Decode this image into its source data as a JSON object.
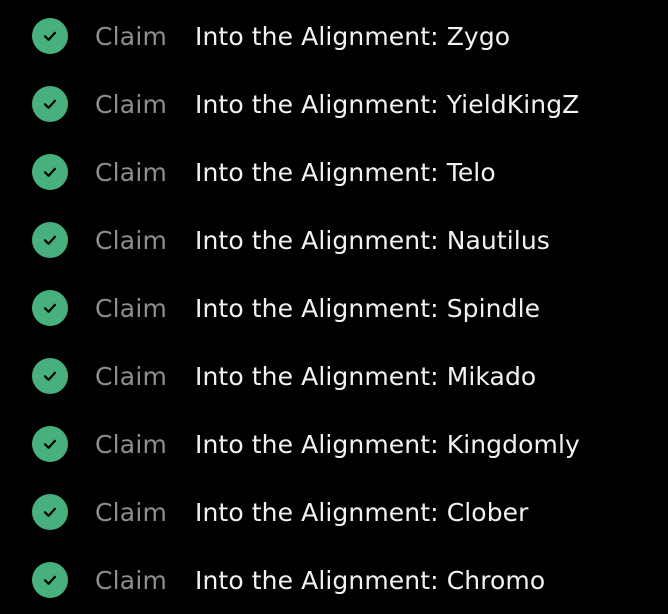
{
  "colors": {
    "background": "#000000",
    "check_badge": "#48b07f",
    "check_mark": "#000000",
    "claim_text": "#8d8d92",
    "title_text": "#f2f2f2"
  },
  "tasks": [
    {
      "status_icon": "check-circle-icon",
      "action": "Claim",
      "title": "Into the Alignment: Zygo"
    },
    {
      "status_icon": "check-circle-icon",
      "action": "Claim",
      "title": "Into the Alignment: YieldKingZ"
    },
    {
      "status_icon": "check-circle-icon",
      "action": "Claim",
      "title": "Into the Alignment: Telo"
    },
    {
      "status_icon": "check-circle-icon",
      "action": "Claim",
      "title": "Into the Alignment: Nautilus"
    },
    {
      "status_icon": "check-circle-icon",
      "action": "Claim",
      "title": "Into the Alignment: Spindle"
    },
    {
      "status_icon": "check-circle-icon",
      "action": "Claim",
      "title": "Into the Alignment: Mikado"
    },
    {
      "status_icon": "check-circle-icon",
      "action": "Claim",
      "title": "Into the Alignment: Kingdomly"
    },
    {
      "status_icon": "check-circle-icon",
      "action": "Claim",
      "title": "Into the Alignment: Clober"
    },
    {
      "status_icon": "check-circle-icon",
      "action": "Claim",
      "title": "Into the Alignment: Chromo"
    }
  ]
}
